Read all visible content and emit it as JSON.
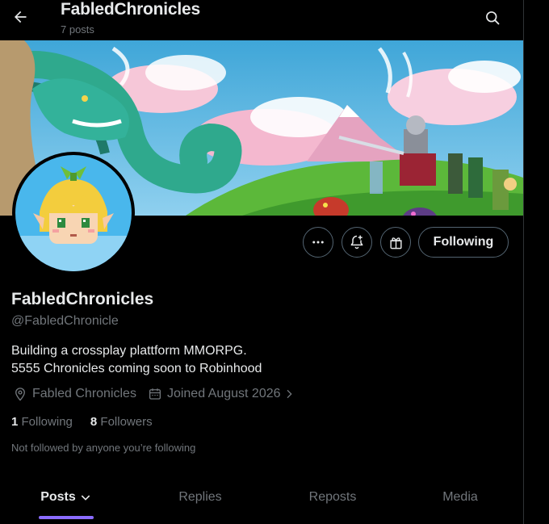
{
  "header": {
    "title": "FabledChronicles",
    "post_count": "7 posts"
  },
  "profile": {
    "display_name": "FabledChronicles",
    "handle": "@FabledChronicle",
    "bio_lines": [
      "Building a crossplay plattform MMORPG.",
      "5555 Chronicles coming soon to Robinhood"
    ],
    "location": "Fabled Chronicles",
    "joined": "Joined August 2026",
    "following_count": "1",
    "following_label": "Following",
    "followers_count": "8",
    "followers_label": "Followers",
    "not_followed_text": "Not followed by anyone you’re following"
  },
  "actions": {
    "follow_label": "Following"
  },
  "tabs": [
    {
      "label": "Posts",
      "active": true
    },
    {
      "label": "Replies",
      "active": false
    },
    {
      "label": "Reposts",
      "active": false
    },
    {
      "label": "Media",
      "active": false
    }
  ],
  "colors": {
    "background": "#000000",
    "text": "#e7e9ea",
    "muted": "#71767b",
    "tab_accent": "#8a6bff",
    "border": "#536471"
  },
  "icons": [
    "back-arrow-icon",
    "search-icon",
    "more-icon",
    "bell-plus-icon",
    "gift-icon",
    "location-icon",
    "calendar-icon",
    "chevron-right-icon",
    "chevron-down-icon"
  ]
}
